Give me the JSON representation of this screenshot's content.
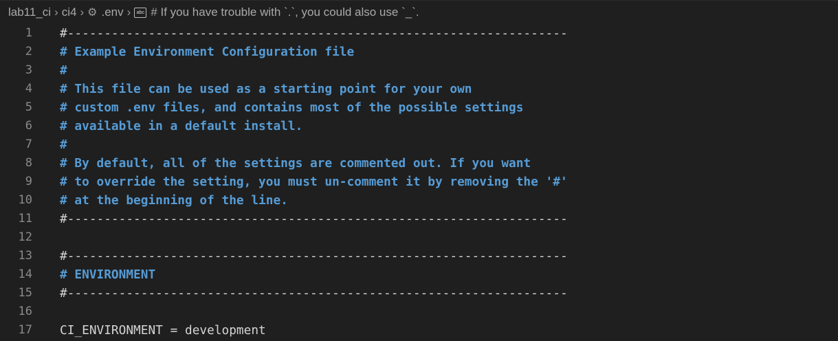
{
  "breadcrumb": {
    "items": [
      "lab11_ci",
      "ci4",
      ".env"
    ],
    "symbol": "# If you have trouble with `.`, you could also use `_`."
  },
  "lines": [
    {
      "n": "1",
      "text": "#--------------------------------------------------------------------",
      "kind": "rule"
    },
    {
      "n": "2",
      "text": "# Example Environment Configuration file",
      "kind": "cm"
    },
    {
      "n": "3",
      "text": "#",
      "kind": "cm"
    },
    {
      "n": "4",
      "text": "# This file can be used as a starting point for your own",
      "kind": "cm"
    },
    {
      "n": "5",
      "text": "# custom .env files, and contains most of the possible settings",
      "kind": "cm"
    },
    {
      "n": "6",
      "text": "# available in a default install.",
      "kind": "cm"
    },
    {
      "n": "7",
      "text": "#",
      "kind": "cm"
    },
    {
      "n": "8",
      "text": "# By default, all of the settings are commented out. If you want",
      "kind": "cm"
    },
    {
      "n": "9",
      "text": "# to override the setting, you must un-comment it by removing the '#'",
      "kind": "cm"
    },
    {
      "n": "10",
      "text": "# at the beginning of the line.",
      "kind": "cm"
    },
    {
      "n": "11",
      "text": "#--------------------------------------------------------------------",
      "kind": "rule"
    },
    {
      "n": "12",
      "text": "",
      "kind": "plain"
    },
    {
      "n": "13",
      "text": "#--------------------------------------------------------------------",
      "kind": "rule"
    },
    {
      "n": "14",
      "text": "# ENVIRONMENT",
      "kind": "cm"
    },
    {
      "n": "15",
      "text": "#--------------------------------------------------------------------",
      "kind": "rule"
    },
    {
      "n": "16",
      "text": "",
      "kind": "plain"
    },
    {
      "n": "17",
      "text": "CI_ENVIRONMENT = development",
      "kind": "plain"
    }
  ]
}
